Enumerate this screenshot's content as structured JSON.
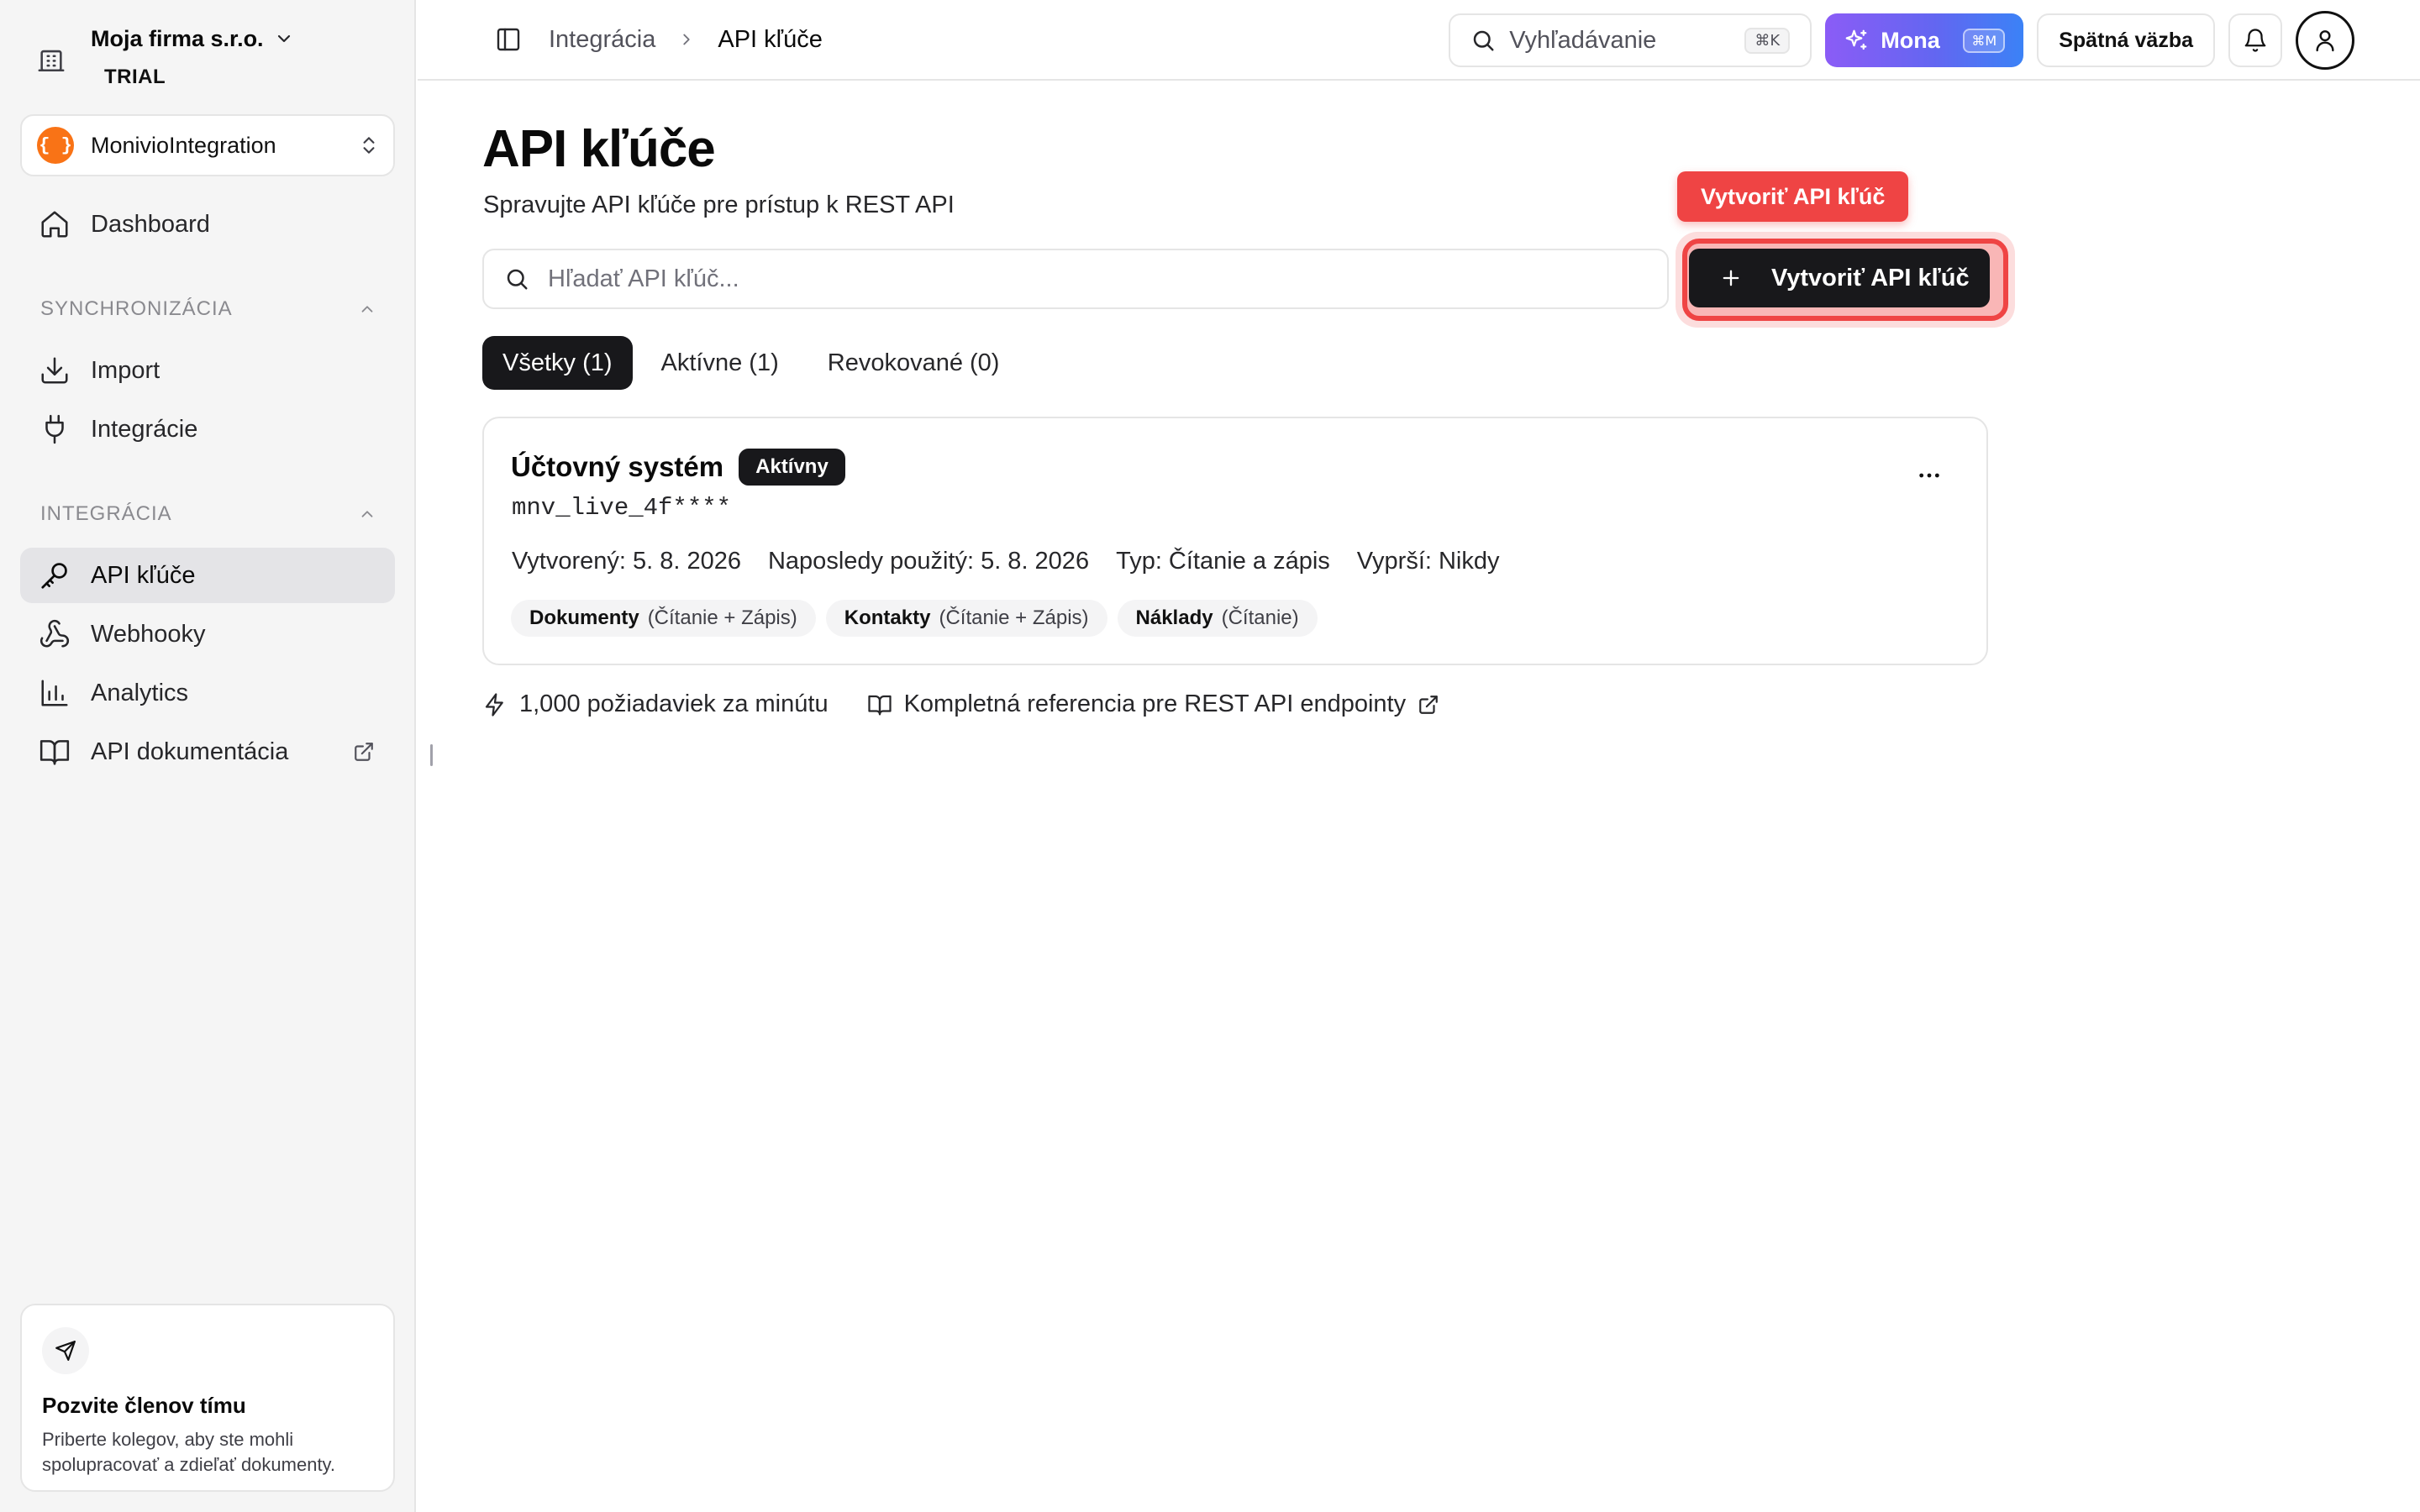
{
  "company": {
    "name": "Moja firma s.r.o.",
    "plan": "TRIAL"
  },
  "workspace": {
    "logo": "{ }",
    "name": "MonivioIntegration"
  },
  "sidebar": {
    "dashboard": "Dashboard",
    "sections": [
      {
        "title": "SYNCHRONIZÁCIA",
        "items": [
          "Import",
          "Integrácie"
        ]
      },
      {
        "title": "INTEGRÁCIA",
        "items": [
          "API kľúče",
          "Webhooky",
          "Analytics",
          "API dokumentácia"
        ]
      }
    ],
    "invite": {
      "title": "Pozvite členov tímu",
      "desc_line1": "Priberte kolegov, aby ste mohli",
      "desc_line2": "spolupracovať a zdieľať dokumenty."
    }
  },
  "header": {
    "breadcrumb": [
      "Integrácia",
      "API kľúče"
    ],
    "search_placeholder": "Vyhľadávanie",
    "search_shortcut": "⌘K",
    "mona_label": "Mona",
    "mona_shortcut": "⌘M",
    "feedback_label": "Spätná väzba"
  },
  "main": {
    "title": "API kľúče",
    "subtitle": "Spravujte API kľúče pre prístup k REST API",
    "search_placeholder": "Hľadať API kľúč...",
    "create_button": "Vytvoriť API kľúč",
    "tooltip": "Vytvoriť API kľúč",
    "tabs": [
      "Všetky (1)",
      "Aktívne (1)",
      "Revokované (0)"
    ],
    "active_tab": 0,
    "key": {
      "name": "Účtovný systém",
      "status": "Aktívny",
      "masked": "mnv_live_4f****",
      "created": "Vytvorený: 5. 8. 2026",
      "last_used": "Naposledy použitý: 5. 8. 2026",
      "type": "Typ: Čítanie a zápis",
      "expires": "Vyprší: Nikdy",
      "scopes": [
        {
          "name": "Dokumenty",
          "perm": "(Čítanie + Zápis)"
        },
        {
          "name": "Kontakty",
          "perm": "(Čítanie + Zápis)"
        },
        {
          "name": "Náklady",
          "perm": "(Čítanie)"
        }
      ]
    },
    "rate_limit": "1,000 požiadaviek za minútu",
    "docs_link": "Kompletná referencia pre REST API endpointy"
  },
  "colors": {
    "accent_dark": "#18181b",
    "highlight_red": "#ef4444",
    "workspace_logo": "#f97316",
    "mona_gradient_start": "#8b5cf6",
    "mona_gradient_end": "#3b82f6"
  },
  "icons": [
    "building-icon",
    "chevron-down-icon",
    "chevrons-up-down-icon",
    "home-icon",
    "download-icon",
    "plug-icon",
    "key-icon",
    "webhook-icon",
    "bar-chart-icon",
    "book-icon",
    "external-link-icon",
    "send-icon",
    "sidebar-toggle-icon",
    "chevron-right-icon",
    "search-icon",
    "sparkles-icon",
    "bell-icon",
    "user-icon",
    "plus-icon",
    "more-horizontal-icon",
    "zap-icon"
  ]
}
